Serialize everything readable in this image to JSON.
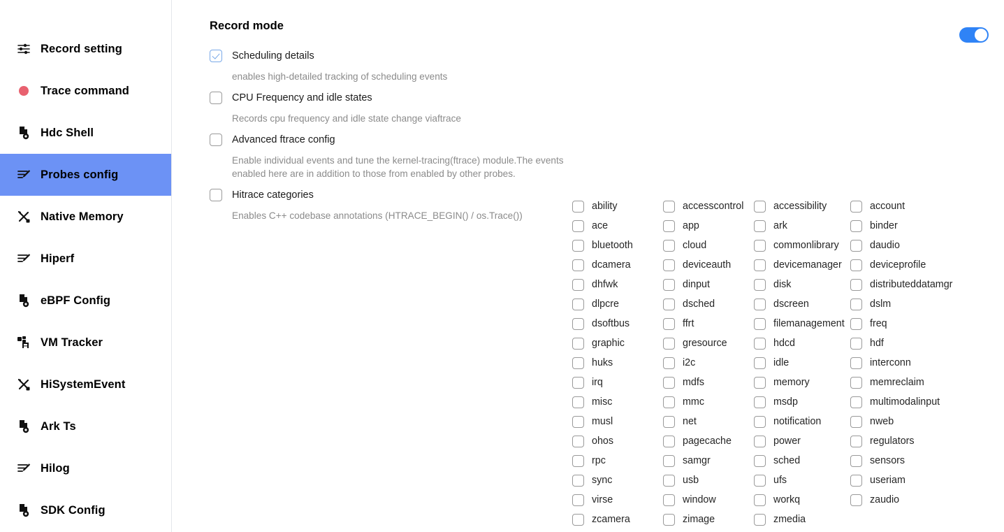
{
  "sidebar": {
    "items": [
      {
        "label": "Record setting",
        "icon": "sliders-icon",
        "selected": false
      },
      {
        "label": "Trace command",
        "icon": "record-dot-icon",
        "selected": false
      },
      {
        "label": "Hdc Shell",
        "icon": "file-gear-icon",
        "selected": false
      },
      {
        "label": "Probes config",
        "icon": "pen-lines-icon",
        "selected": true
      },
      {
        "label": "Native Memory",
        "icon": "tools-icon",
        "selected": false
      },
      {
        "label": "Hiperf",
        "icon": "pen-lines-icon",
        "selected": false
      },
      {
        "label": "eBPF Config",
        "icon": "file-gear-icon",
        "selected": false
      },
      {
        "label": "VM Tracker",
        "icon": "vm-icon",
        "selected": false
      },
      {
        "label": "HiSystemEvent",
        "icon": "tools-icon",
        "selected": false
      },
      {
        "label": "Ark Ts",
        "icon": "file-gear-icon",
        "selected": false
      },
      {
        "label": "Hilog",
        "icon": "pen-lines-icon",
        "selected": false
      },
      {
        "label": "SDK Config",
        "icon": "file-gear-icon",
        "selected": false
      }
    ]
  },
  "main": {
    "title": "Record mode",
    "master_toggle": {
      "name": "record-mode-toggle",
      "on": true
    },
    "options": [
      {
        "label": "Scheduling details",
        "desc": "enables high-detailed tracking of scheduling events",
        "checked": true
      },
      {
        "label": "CPU Frequency and idle states",
        "desc": "Records cpu frequency and idle state change viaftrace",
        "checked": false
      },
      {
        "label": "Advanced ftrace config",
        "desc": "Enable individual events and tune the kernel-tracing(ftrace) module.The events enabled here are in addition to those from enabled by other probes.",
        "checked": false
      },
      {
        "label": "Hitrace categories",
        "desc": "Enables C++ codebase annotations (HTRACE_BEGIN() / os.Trace())",
        "checked": false
      }
    ],
    "categories": {
      "col1": [
        "ability",
        "ace",
        "bluetooth",
        "dcamera",
        "dhfwk",
        "dlpcre",
        "dsoftbus",
        "graphic",
        "huks",
        "irq",
        "misc",
        "musl",
        "ohos",
        "rpc",
        "sync",
        "virse",
        "zcamera"
      ],
      "col2": [
        "accesscontrol",
        "app",
        "cloud",
        "deviceauth",
        "dinput",
        "dsched",
        "ffrt",
        "gresource",
        "i2c",
        "mdfs",
        "mmc",
        "net",
        "pagecache",
        "samgr",
        "usb",
        "window",
        "zimage"
      ],
      "col3": [
        "accessibility",
        "ark",
        "commonlibrary",
        "devicemanager",
        "disk",
        "dscreen",
        "filemanagement",
        "hdcd",
        "idle",
        "memory",
        "msdp",
        "notification",
        "power",
        "sched",
        "ufs",
        "workq",
        "zmedia"
      ],
      "col4": [
        "account",
        "binder",
        "daudio",
        "deviceprofile",
        "distributeddatamgr",
        "dslm",
        "freq",
        "hdf",
        "interconn",
        "memreclaim",
        "multimodalinput",
        "nweb",
        "regulators",
        "sensors",
        "useriam",
        "zaudio"
      ]
    }
  },
  "colors": {
    "sidebar_selected": "#6c92f5",
    "toggle_on": "#2f83f6",
    "record_dot": "#e8616f",
    "checkbox_checked": "#7aa9e8"
  }
}
